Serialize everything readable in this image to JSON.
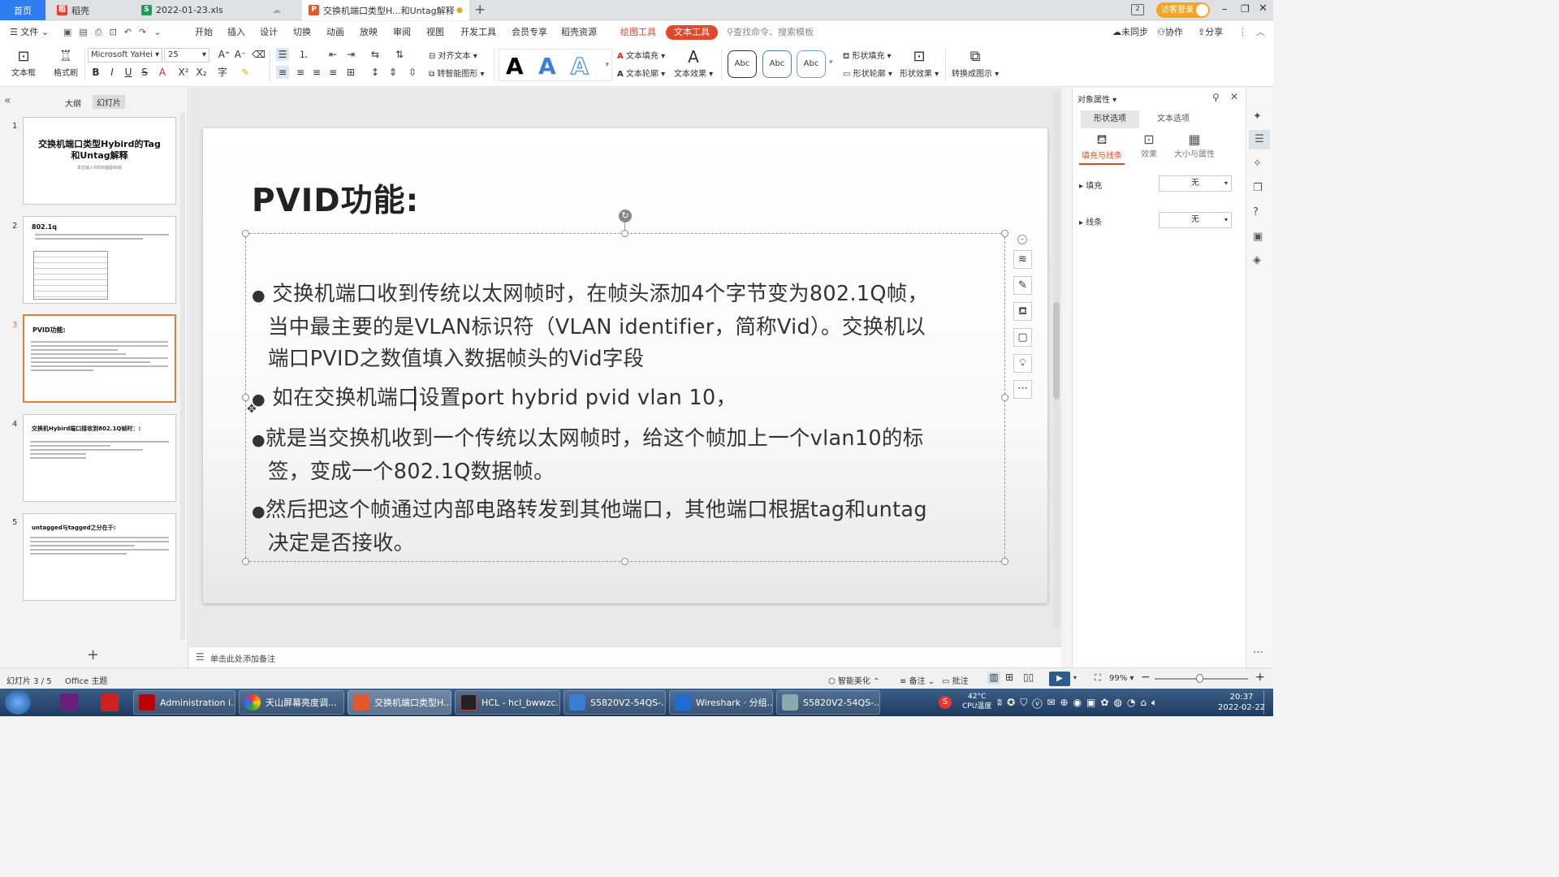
{
  "tabs": [
    {
      "label": "首页",
      "icon": "home"
    },
    {
      "label": "稻壳",
      "icon": "docer-icon"
    },
    {
      "label": "2022-01-23.xls",
      "icon": "spreadsheet-icon"
    },
    {
      "label": "交换机端口类型H...和Untag解释",
      "icon": "presentation-icon"
    }
  ],
  "user_button": "访客登录",
  "menu": {
    "file": "文件",
    "items": [
      "开始",
      "插入",
      "设计",
      "切换",
      "动画",
      "放映",
      "审阅",
      "视图",
      "开发工具",
      "会员专享",
      "稻壳资源"
    ],
    "drawing_tools": "绘图工具",
    "text_tools": "文本工具",
    "search_placeholder": "查找命令、搜索模板",
    "unsynced": "未同步",
    "collaborate": "协作",
    "share": "分享"
  },
  "ribbon": {
    "text_box": "文本框",
    "format_painter": "格式刷",
    "font_name": "Microsoft YaHei",
    "font_size": "25",
    "align_text": "对齐文本",
    "to_smartart": "转智能图形",
    "text_fill": "文本填充",
    "text_outline": "文本轮廓",
    "text_effect": "文本效果",
    "abc": "Abc",
    "shape_fill": "形状填充",
    "shape_outline": "形状轮廓",
    "shape_effect": "形状效果",
    "convert_to_figure": "转换成图示"
  },
  "left_panel": {
    "tab_outline": "大纲",
    "tab_slides": "幻灯片",
    "add_slide": "+"
  },
  "thumbnails": [
    {
      "num": "1",
      "title": "交换机端口类型Hybird的Tag和Untag解释",
      "subtitle": "单击输入你的封面副标题"
    },
    {
      "num": "2",
      "title": "802.1q"
    },
    {
      "num": "3",
      "title": "PVID功能:"
    },
    {
      "num": "4",
      "title": "交换机Hybird端口接收到802.1Q帧时：:"
    },
    {
      "num": "5",
      "title": "untagged与tagged之分在于:"
    }
  ],
  "slide": {
    "title": "PVID功能:",
    "bullets": [
      {
        "bullet": "●",
        "lines": [
          " 交换机端口收到传统以太网帧时，在帧头添加4个字节变为802.1Q帧，",
          "当中最主要的是VLAN标识符（VLAN identifier，简称Vid）。交换机以",
          "端口PVID之数值填入数据帧头的Vid字段"
        ]
      },
      {
        "bullet": "●",
        "lines": [
          " 如在交换机端口设置port hybrid pvid vlan 10，"
        ]
      },
      {
        "bullet": "●",
        "lines": [
          "就是当交换机收到一个传统以太网帧时，给这个帧加上一个vlan10的标",
          "签，变成一个802.1Q数据帧。"
        ]
      },
      {
        "bullet": "●",
        "lines": [
          "然后把这个帧通过内部电路转发到其他端口，其他端口根据tag和untag",
          "决定是否接收。"
        ]
      }
    ]
  },
  "right_panel": {
    "title": "对象属性",
    "tab_shape": "形状选项",
    "tab_text": "文本选项",
    "sub_fill_line": "填充与线条",
    "sub_effect": "效果",
    "sub_size": "大小与属性",
    "fill_label": "填充",
    "fill_value": "无",
    "line_label": "线条",
    "line_value": "无"
  },
  "notes_placeholder": "单击此处添加备注",
  "status": {
    "slide_index": "幻灯片 3 / 5",
    "theme": "Office 主题",
    "beautify": "智能美化",
    "notes": "备注",
    "comments": "批注",
    "zoom": "99%"
  },
  "taskbar": {
    "items": [
      "Administration i...",
      "天山屏幕亮度调...",
      "交换机端口类型H...",
      "HCL - hcl_bwwzc...",
      "S5820V2-54QS-...",
      "Wireshark · 分组...",
      "S5820V2-54QS-..."
    ],
    "temp": "42°C",
    "cpu_label": "CPU温度",
    "time": "20:37",
    "date": "2022-02-22"
  },
  "colors": {
    "accent_orange": "#e04a2a",
    "home_blue": "#2f7cf0",
    "selected_border": "#e07f3a"
  }
}
